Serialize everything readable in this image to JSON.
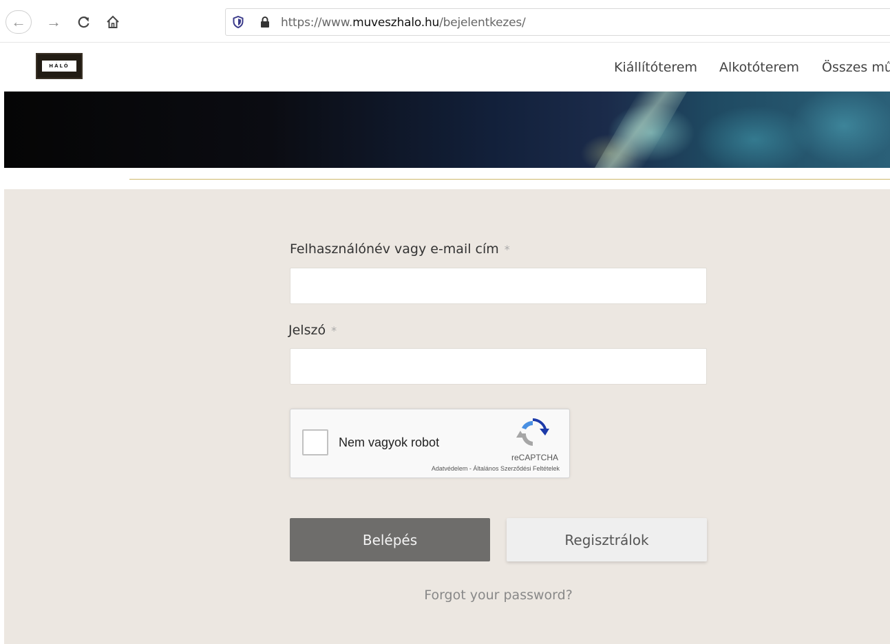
{
  "browser": {
    "url_prefix": "https://www.",
    "url_domain": "muveszhalo.hu",
    "url_path": "/bejelentkezes/"
  },
  "header": {
    "logo_text": "HÁLÓ",
    "nav": [
      "Kiállítóterem",
      "Alkotóterem",
      "Összes mű"
    ]
  },
  "form": {
    "username_label": "Felhasználónév vagy e-mail cím",
    "username_value": "",
    "password_label": "Jelszó",
    "password_value": "",
    "required_mark": "*",
    "captcha_label": "Nem vagyok robot",
    "captcha_brand": "reCAPTCHA",
    "captcha_links": "Adatvédelem - Általános Szerződési Feltételek",
    "login_button": "Belépés",
    "register_button": "Regisztrálok",
    "forgot_link": "Forgot your password?"
  },
  "colors": {
    "content_bg": "#ece7e1",
    "login_button_bg": "#6e6d6b",
    "accent_line": "#cdb86a"
  }
}
